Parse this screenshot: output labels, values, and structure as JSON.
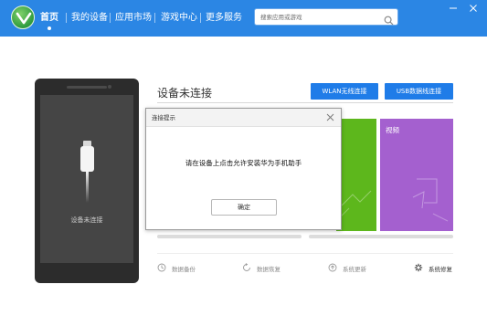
{
  "nav": {
    "items": [
      {
        "label": "首页",
        "active": true
      },
      {
        "label": "我的设备"
      },
      {
        "label": "应用市场"
      },
      {
        "label": "游戏中心"
      },
      {
        "label": "更多服务"
      }
    ]
  },
  "search": {
    "placeholder": "搜索应用或游戏"
  },
  "window": {
    "icons": [
      "minimize-icon",
      "close-icon"
    ]
  },
  "phone": {
    "status": "设备未连接"
  },
  "panel": {
    "title": "设备未连接",
    "buttons": {
      "wlan": "WLAN无线连接",
      "usb": "USB数据线连接"
    },
    "tiles": [
      {
        "color": "#5db71c"
      },
      {
        "label": "视频",
        "color": "#a460cf"
      }
    ],
    "actions": [
      {
        "label": "数据备份",
        "icon": "backup-icon"
      },
      {
        "label": "数据恢复",
        "icon": "restore-icon"
      },
      {
        "label": "系统更新",
        "icon": "update-icon"
      },
      {
        "label": "系统修复",
        "icon": "repair-icon"
      }
    ]
  },
  "dialog": {
    "title": "连接提示",
    "message": "请在设备上点击允许安装华为手机助手",
    "ok_label": "确定"
  },
  "colors": {
    "accent": "#2b86e4",
    "button": "#1f7ce8"
  }
}
